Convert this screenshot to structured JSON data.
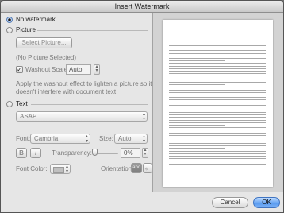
{
  "window": {
    "title": "Insert Watermark"
  },
  "options": {
    "no_watermark": "No watermark",
    "picture": "Picture",
    "text": "Text"
  },
  "picture_section": {
    "select_button": "Select Picture...",
    "status": "(No Picture Selected)",
    "washout_label": "Washout",
    "scale_label": "Scale:",
    "scale_value": "Auto",
    "help_text_line1": "Apply the washout effect to lighten a picture so it",
    "help_text_line2": "doesn't interfere with document text"
  },
  "text_section": {
    "text_value": "ASAP",
    "font_label": "Font:",
    "font_value": "Cambria",
    "size_label": "Size:",
    "size_value": "Auto",
    "bold_label": "B",
    "italic_label": "I",
    "transparency_label": "Transparency:",
    "transparency_value": "0%",
    "font_color_label": "Font Color:",
    "orientation_label": "Orientation:",
    "orientation_horizontal": "abc"
  },
  "buttons": {
    "cancel": "Cancel",
    "ok": "OK"
  },
  "colors": {
    "accent": "#4a8ee8",
    "ok_button": "#5b9cf0",
    "window_bg": "#e6e6e6"
  }
}
